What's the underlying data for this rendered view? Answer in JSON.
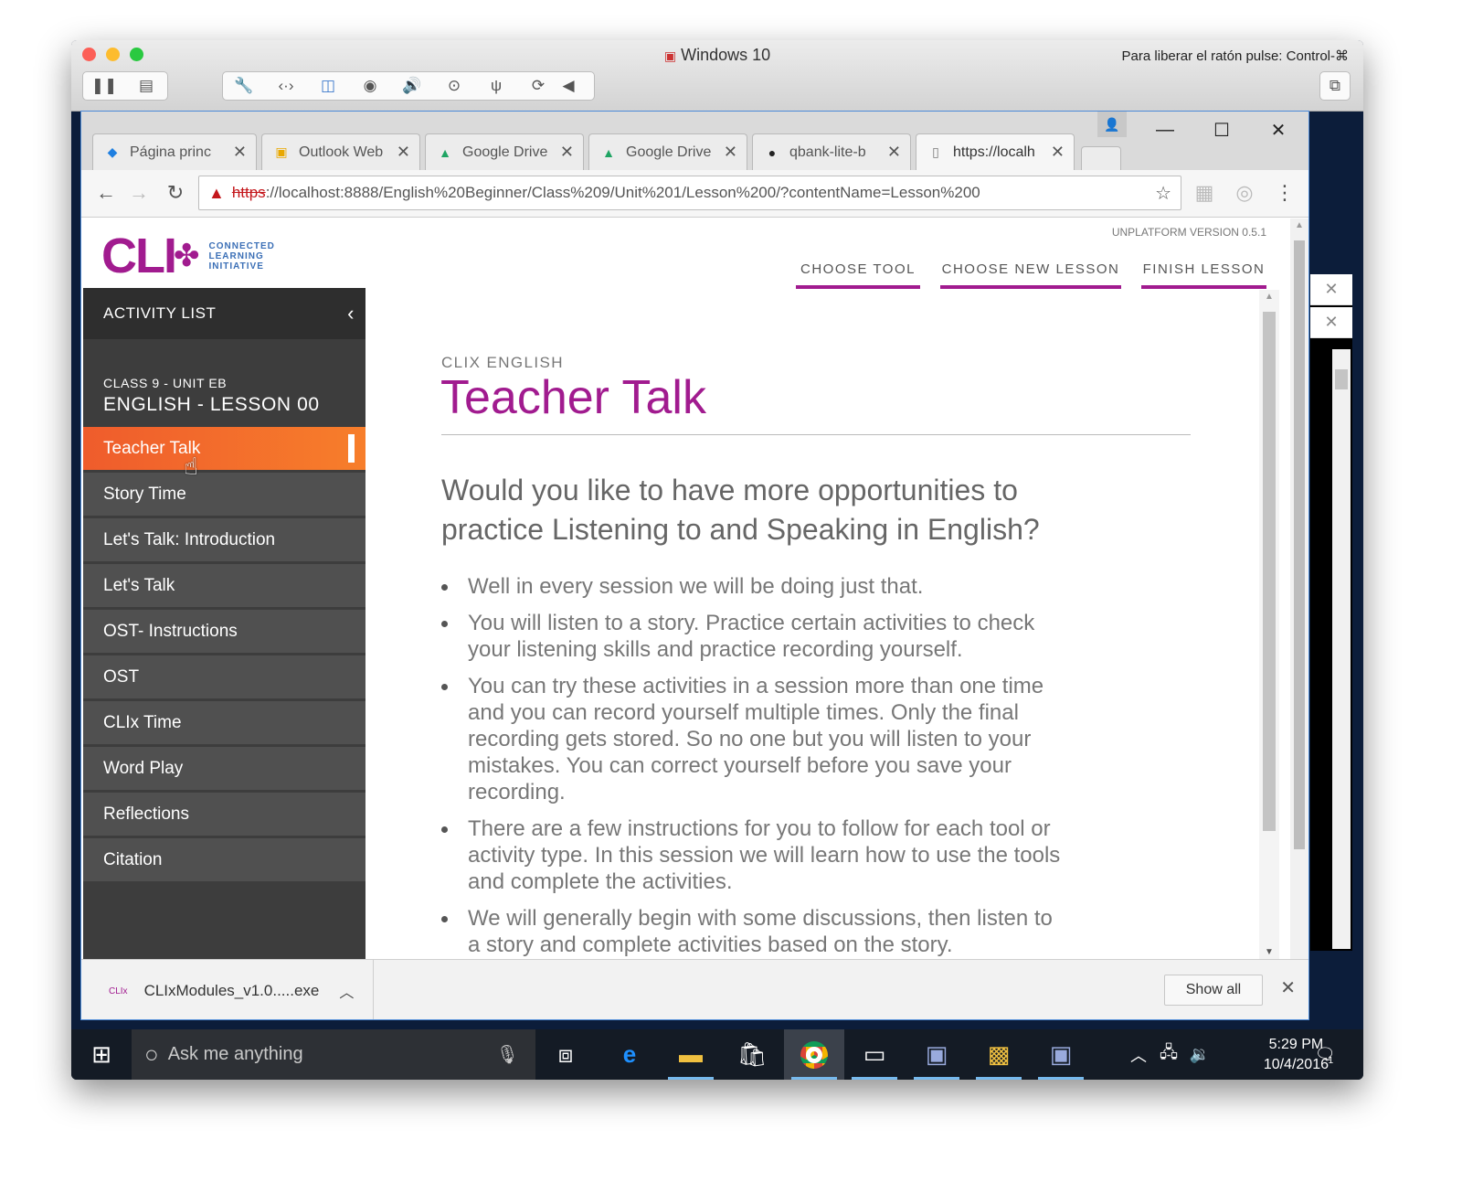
{
  "vm": {
    "title": "Windows 10",
    "release_hint": "Para liberar el ratón pulse: Control-⌘"
  },
  "browser": {
    "tabs": [
      {
        "title": "Página princ",
        "icon": "dropbox-icon"
      },
      {
        "title": "Outlook Web",
        "icon": "outlook-icon"
      },
      {
        "title": "Google Drive",
        "icon": "google-drive-icon"
      },
      {
        "title": "Google Drive",
        "icon": "google-drive-icon"
      },
      {
        "title": "qbank-lite-b",
        "icon": "github-icon"
      },
      {
        "title": "https://localh",
        "icon": "page-icon"
      }
    ],
    "url_scheme": "https",
    "url_rest": "://localhost:8888/English%20Beginner/Class%209/Unit%201/Lesson%200/?contentName=Lesson%200"
  },
  "app": {
    "logo_text": "CLI",
    "logo_sub": [
      "CONNECTED",
      "LEARNING",
      "INITIATIVE"
    ],
    "version": "UNPLATFORM VERSION 0.5.1",
    "nav": [
      "CHOOSE TOOL",
      "CHOOSE NEW LESSON",
      "FINISH LESSON"
    ],
    "accent": "#a11b8f"
  },
  "sidebar": {
    "header": "ACTIVITY LIST",
    "class_line": "CLASS 9 - UNIT EB",
    "lesson_line": "ENGLISH - LESSON 00",
    "items": [
      "Teacher Talk",
      "Story Time",
      "Let's Talk: Introduction",
      "Let's Talk",
      "OST- Instructions",
      "OST",
      "CLIx Time",
      "Word Play",
      "Reflections",
      "Citation"
    ],
    "active_index": 0
  },
  "content": {
    "eyebrow": "CLIX ENGLISH",
    "title": "Teacher Talk",
    "lead": "Would you like to have more opportunities to practice Listening to and Speaking in English?",
    "bullets": [
      "Well in every session we will be doing just that.",
      "You will listen to a story. Practice certain activities to check your listening skills and practice recording yourself.",
      "You can try these activities in a session more than one time and you can record yourself multiple times. Only the final recording gets stored. So no one but you will listen to your mistakes. You can correct yourself before you save your recording.",
      "There are a few instructions for you to follow for each tool or activity type. In this session we will learn how to use the tools and complete the activities.",
      "We will generally begin with some discussions, then listen to a story and complete activities based on the story."
    ]
  },
  "download": {
    "file": "CLIxModules_v1.0.....exe",
    "show_all": "Show all"
  },
  "taskbar": {
    "search_placeholder": "Ask me anything",
    "time": "5:29 PM",
    "date": "10/4/2016",
    "notification_count": "1"
  }
}
